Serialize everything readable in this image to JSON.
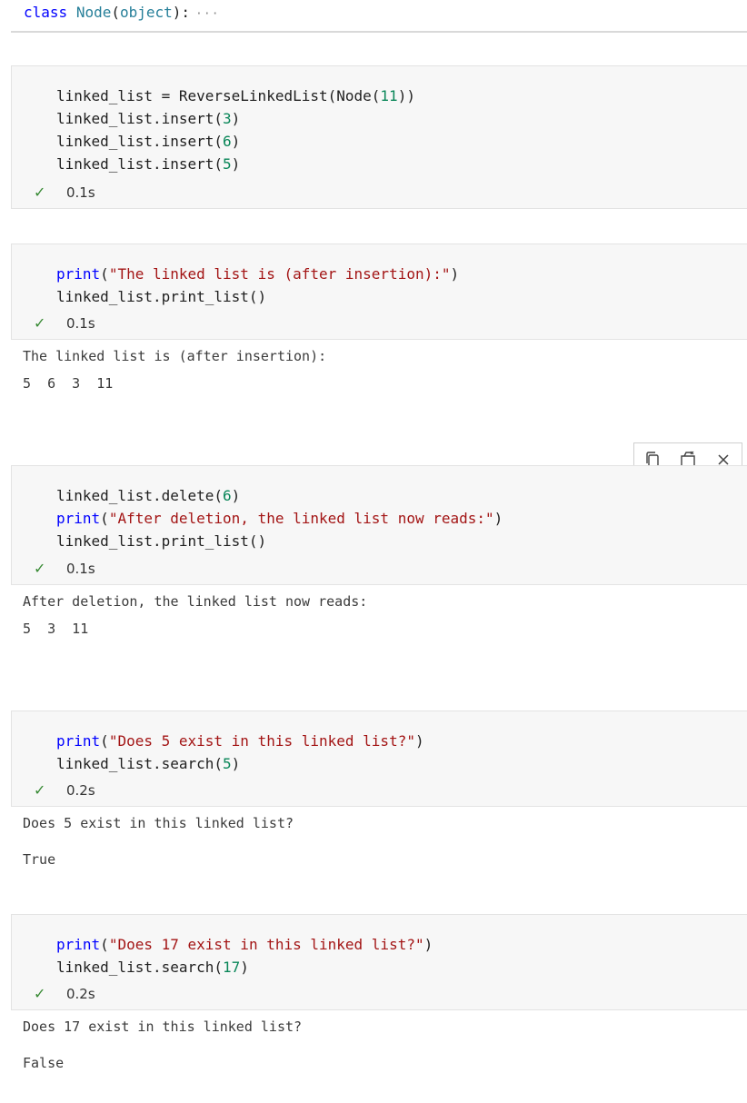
{
  "collapsed_cell": {
    "keyword": "class",
    "class_name": "Node",
    "paren_open": "(",
    "base": "object",
    "paren_close": "):",
    "ellipsis": "···"
  },
  "cells": [
    {
      "lines": [
        [
          {
            "t": "linked_list = ReverseLinkedList(Node(",
            "c": ""
          },
          {
            "t": "11",
            "c": "num"
          },
          {
            "t": "))",
            "c": ""
          }
        ],
        [
          {
            "t": "linked_list.insert(",
            "c": ""
          },
          {
            "t": "3",
            "c": "num"
          },
          {
            "t": ")",
            "c": ""
          }
        ],
        [
          {
            "t": "linked_list.insert(",
            "c": ""
          },
          {
            "t": "6",
            "c": "num"
          },
          {
            "t": ")",
            "c": ""
          }
        ],
        [
          {
            "t": "linked_list.insert(",
            "c": ""
          },
          {
            "t": "5",
            "c": "num"
          },
          {
            "t": ")",
            "c": ""
          }
        ]
      ],
      "status_time": "0.1s",
      "output": []
    },
    {
      "lines": [
        [
          {
            "t": "print",
            "c": "fn"
          },
          {
            "t": "(",
            "c": ""
          },
          {
            "t": "\"The linked list is (after insertion):\"",
            "c": "str"
          },
          {
            "t": ")",
            "c": ""
          }
        ],
        [
          {
            "t": "linked_list.print_list()",
            "c": ""
          }
        ]
      ],
      "status_time": "0.1s",
      "output": [
        "The linked list is (after insertion):",
        "5  6  3  11"
      ]
    },
    {
      "lines": [
        [
          {
            "t": "linked_list.delete(",
            "c": ""
          },
          {
            "t": "6",
            "c": "num"
          },
          {
            "t": ")",
            "c": ""
          }
        ],
        [
          {
            "t": "print",
            "c": "fn"
          },
          {
            "t": "(",
            "c": ""
          },
          {
            "t": "\"After deletion, the linked list now reads:\"",
            "c": "str"
          },
          {
            "t": ")",
            "c": ""
          }
        ],
        [
          {
            "t": "linked_list.print_list()",
            "c": ""
          }
        ]
      ],
      "status_time": "0.1s",
      "output": [
        "After deletion, the linked list now reads:",
        "5  3  11"
      ]
    },
    {
      "lines": [
        [
          {
            "t": "print",
            "c": "fn"
          },
          {
            "t": "(",
            "c": ""
          },
          {
            "t": "\"Does 5 exist in this linked list?\"",
            "c": "str"
          },
          {
            "t": ")",
            "c": ""
          }
        ],
        [
          {
            "t": "linked_list.search(",
            "c": ""
          },
          {
            "t": "5",
            "c": "num"
          },
          {
            "t": ")",
            "c": ""
          }
        ]
      ],
      "status_time": "0.2s",
      "output": [
        "Does 5 exist in this linked list?",
        "True"
      ]
    },
    {
      "lines": [
        [
          {
            "t": "print",
            "c": "fn"
          },
          {
            "t": "(",
            "c": ""
          },
          {
            "t": "\"Does 17 exist in this linked list?\"",
            "c": "str"
          },
          {
            "t": ")",
            "c": ""
          }
        ],
        [
          {
            "t": "linked_list.search(",
            "c": ""
          },
          {
            "t": "17",
            "c": "num"
          },
          {
            "t": ")",
            "c": ""
          }
        ]
      ],
      "status_time": "0.2s",
      "output": [
        "Does 17 exist in this linked list?",
        "False"
      ]
    }
  ],
  "icons": {
    "status": "checkmark-icon",
    "toolbar": [
      "copy-icon",
      "clear-output-icon",
      "close-icon"
    ]
  },
  "colors": {
    "keyword": "#0000ff",
    "class_name": "#267f99",
    "string": "#a31515",
    "number": "#098658",
    "success": "#388a34"
  }
}
